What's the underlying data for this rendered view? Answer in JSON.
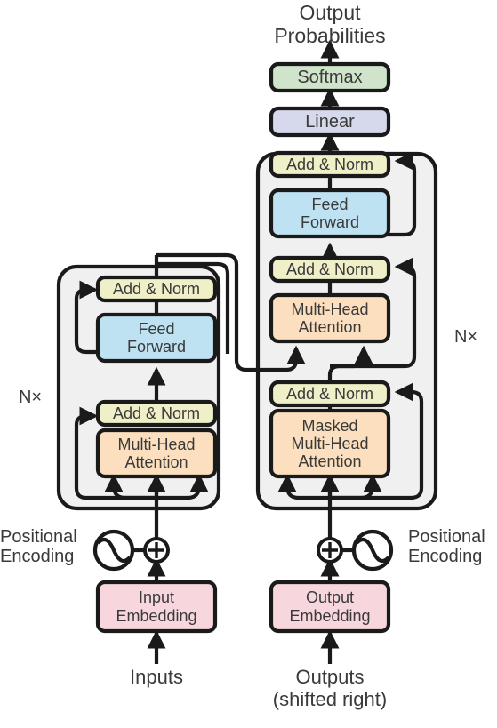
{
  "figure": {
    "name": "Transformer model architecture",
    "type": "block-diagram"
  },
  "colors": {
    "addnorm": "#f0f0c8",
    "feedforward": "#bfe2f3",
    "attention": "#fbdfbe",
    "softmax": "#cfe4ca",
    "linear": "#d6d9ec",
    "embedding": "#f7d7dd",
    "panel": "#f0f0f0",
    "stroke": "#1a1a1a",
    "text": "#3a3a3a"
  },
  "labels": {
    "output_probabilities": "Output\nProbabilities",
    "inputs": "Inputs",
    "outputs": "Outputs\n(shifted right)",
    "positional_encoding_left": "Positional\nEncoding",
    "positional_encoding_right": "Positional\nEncoding",
    "encoder_repeat": "N×",
    "decoder_repeat": "N×"
  },
  "blocks": {
    "softmax": "Softmax",
    "linear": "Linear",
    "input_embedding": "Input\nEmbedding",
    "output_embedding": "Output\nEmbedding",
    "encoder": {
      "add_norm_top": "Add & Norm",
      "feed_forward": "Feed\nForward",
      "add_norm_bottom": "Add & Norm",
      "multi_head_attention": "Multi-Head\nAttention"
    },
    "decoder": {
      "add_norm_top": "Add & Norm",
      "feed_forward": "Feed\nForward",
      "add_norm_mid": "Add & Norm",
      "multi_head_attention": "Multi-Head\nAttention",
      "add_norm_bottom": "Add & Norm",
      "masked_multi_head_attention": "Masked\nMulti-Head\nAttention"
    }
  },
  "symbols": {
    "add_left": "⊕",
    "add_right": "⊕"
  }
}
